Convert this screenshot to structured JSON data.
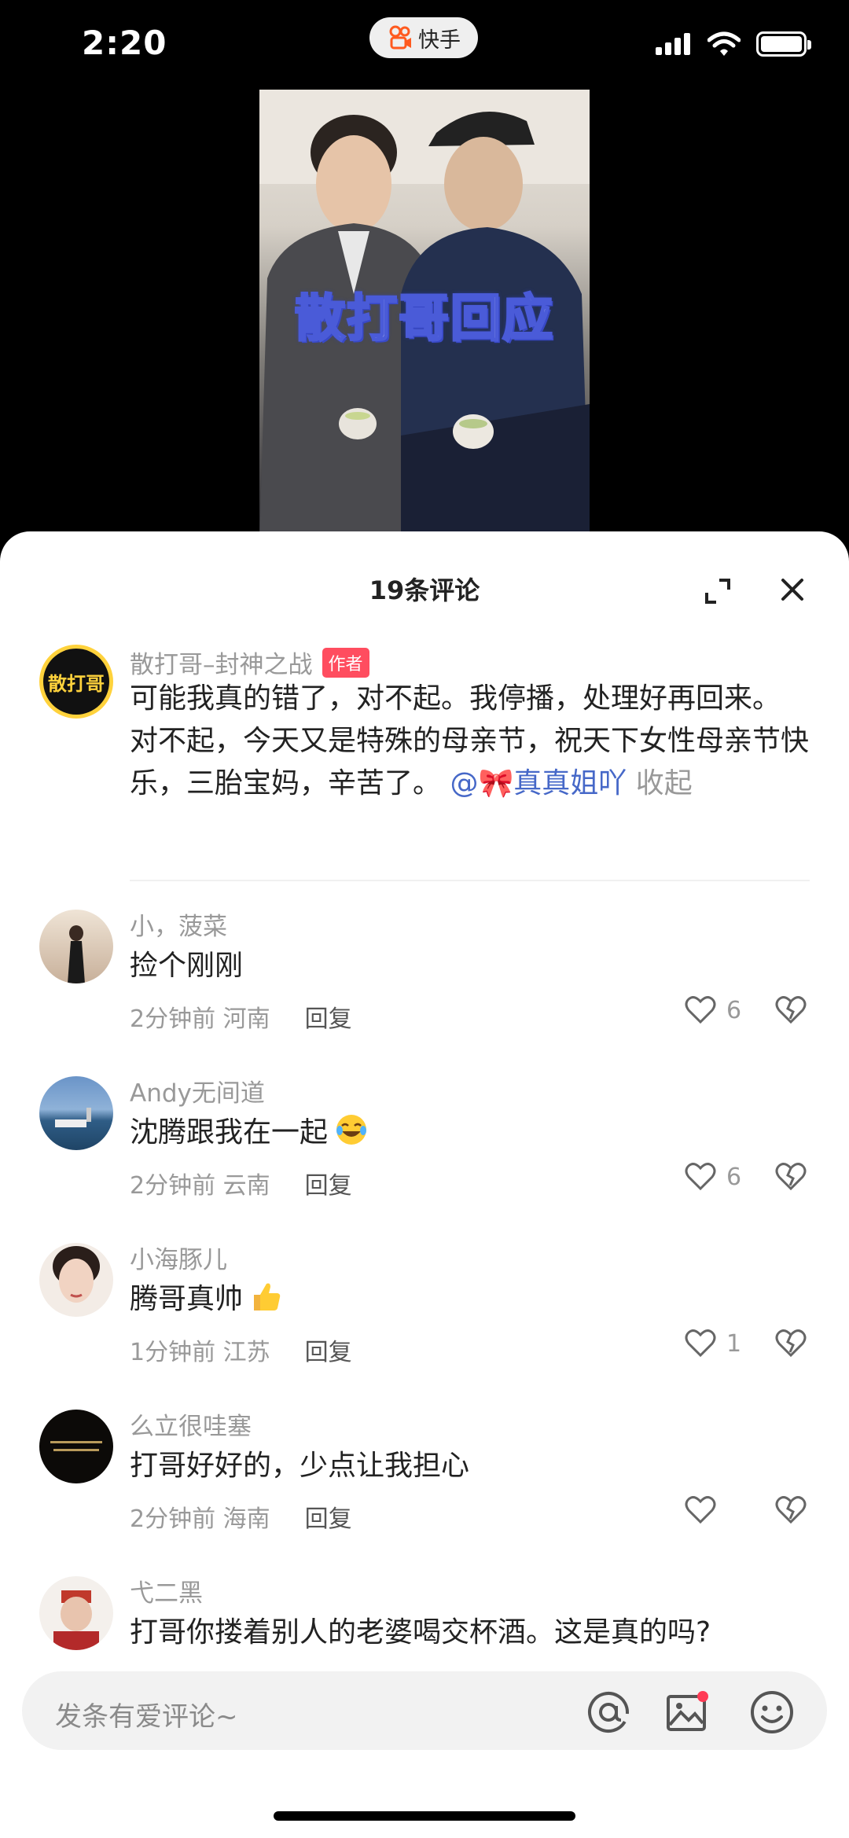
{
  "status_bar": {
    "time": "2:20",
    "app_name": "快手"
  },
  "video": {
    "caption": "散打哥回应"
  },
  "sheet": {
    "title": "19条评论"
  },
  "author_comment": {
    "avatar_text": "散打哥",
    "username": "散打哥–封神之战",
    "badge": "作者",
    "text": "可能我真的错了，对不起。我停播，处理好再回来。 对不起，今天又是特殊的母亲节，祝天下女性母亲节快乐，三胎宝妈，辛苦了。",
    "mention": "@🎀真真姐吖",
    "collapse": "收起"
  },
  "comments": [
    {
      "username": "小，菠菜",
      "text": "捡个刚刚",
      "time": "2分钟前",
      "location": "河南",
      "reply": "回复",
      "likes": "6",
      "emoji": ""
    },
    {
      "username": "Andy无间道",
      "text": "沈腾跟我在一起",
      "time": "2分钟前",
      "location": "云南",
      "reply": "回复",
      "likes": "6",
      "emoji": "laughing-tears"
    },
    {
      "username": "小海豚儿",
      "text": "腾哥真帅",
      "time": "1分钟前",
      "location": "江苏",
      "reply": "回复",
      "likes": "1",
      "emoji": "thumbs-up"
    },
    {
      "username": "么立很哇塞",
      "text": "打哥好好的，少点让我担心",
      "time": "2分钟前",
      "location": "海南",
      "reply": "回复",
      "likes": "",
      "emoji": ""
    },
    {
      "username": "弋二黑",
      "text": "打哥你搂着别人的老婆喝交杯酒。这是真的吗?",
      "time": "",
      "location": "",
      "reply": "",
      "likes": "",
      "emoji": ""
    }
  ],
  "input": {
    "placeholder": "发条有爱评论~"
  },
  "colors": {
    "mention": "#4668c8",
    "author_badge": "#ff4d5f",
    "caption_stroke": "#4a5bd8"
  }
}
